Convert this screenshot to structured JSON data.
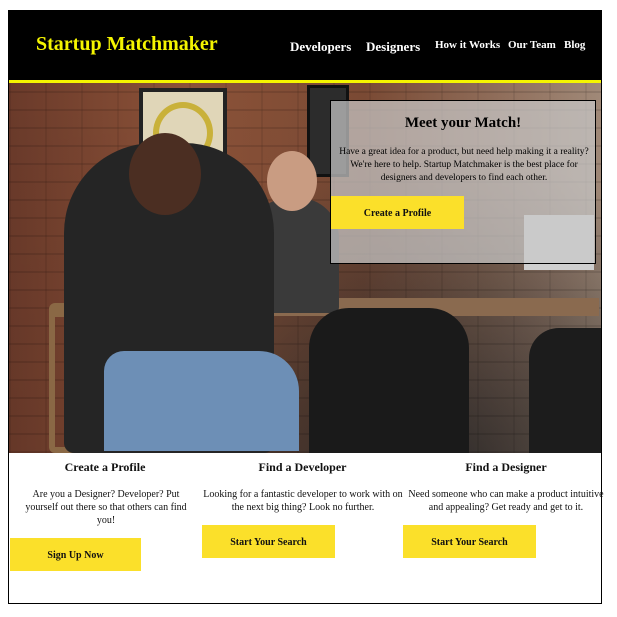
{
  "header": {
    "brand": "Startup Matchmaker",
    "nav": [
      "Developers",
      "Designers",
      "How it Works",
      "Our Team",
      "Blog"
    ]
  },
  "hero": {
    "title": "Meet your Match!",
    "text": "Have a great idea for a product, but need help making it a reality? We're here to help. Startup Matchmaker is the best place for designers and developers to find each other.",
    "button": "Create a Profile"
  },
  "features": [
    {
      "title": "Create a Profile",
      "text": "Are you a Designer? Developer? Put yourself out there so that others can find you!",
      "button": "Sign Up Now"
    },
    {
      "title": "Find a Developer",
      "text": "Looking for a fantastic developer to work with on the next big thing? Look no further.",
      "button": "Start Your Search"
    },
    {
      "title": "Find a Designer",
      "text": "Need someone who can make a product intuitive and appealing? Get ready and get to it.",
      "button": "Start Your Search"
    }
  ],
  "colors": {
    "header_bg": "#000000",
    "brand": "#f5f500",
    "accent": "#fbe02a"
  }
}
